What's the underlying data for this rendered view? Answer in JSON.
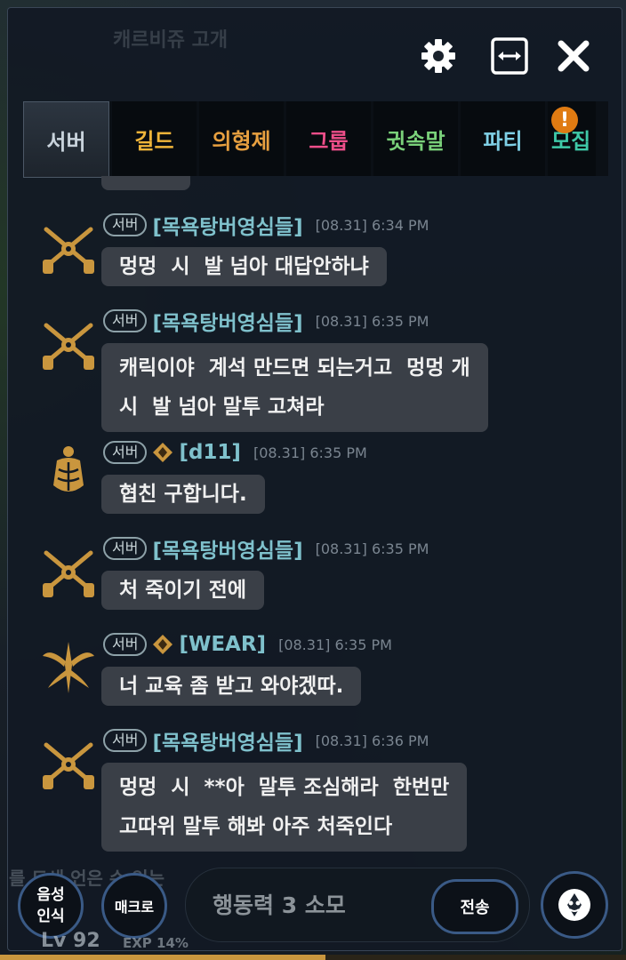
{
  "header": {
    "bg_title": "캐르비쥬 고개",
    "settings_icon": "gear-icon",
    "resize_icon": "expand-horizontal-icon",
    "close_icon": "close-icon"
  },
  "tabs": [
    {
      "label": "서버",
      "color": "#c9d3dc",
      "active": true
    },
    {
      "label": "길드",
      "color": "#f0b53a"
    },
    {
      "label": "의형제",
      "color": "#e8a040"
    },
    {
      "label": "그룹",
      "color": "#ef4f8a"
    },
    {
      "label": "귓속말",
      "color": "#7ad17a"
    },
    {
      "label": "파티",
      "color": "#7fd0e6"
    },
    {
      "label": "모집",
      "color": "#3fc9a8"
    }
  ],
  "tab_alert": "!",
  "messages": [
    {
      "channel": "서버",
      "name": "[목욕탕버영심들]",
      "time": "[08.31] 6:34 PM",
      "text": "멍멍  시  발 넘아 대답안하냐",
      "avatar": "crossed-pistols-icon"
    },
    {
      "channel": "서버",
      "name": "[목욕탕버영심들]",
      "time": "[08.31] 6:35 PM",
      "text": "캐릭이야  계석 만드면 되는거고  멍멍 개\n시  발 넘아 말투 고쳐라",
      "avatar": "crossed-pistols-icon"
    },
    {
      "channel": "서버",
      "name": "[d11]",
      "time": "[08.31] 6:35 PM",
      "text": "협친 구합니다.",
      "avatar": "armored-warrior-icon",
      "rank_icon": "rank-diamond-icon"
    },
    {
      "channel": "서버",
      "name": "[목욕탕버영심들]",
      "time": "[08.31] 6:35 PM",
      "text": "처 죽이기 전에",
      "avatar": "crossed-pistols-icon"
    },
    {
      "channel": "서버",
      "name": "[WEAR]",
      "time": "[08.31] 6:35 PM",
      "text": "너 교육 좀 받고 와야겠따.",
      "avatar": "winged-dagger-icon",
      "rank_icon": "rank-diamond-icon"
    },
    {
      "channel": "서버",
      "name": "[목욕탕버영심들]",
      "time": "[08.31] 6:36 PM",
      "text": "멍멍  시  **아  말투 조심해라  한번만\n고따위 말투 해봐 아주 처죽인다",
      "avatar": "crossed-pistols-icon"
    }
  ],
  "bottom": {
    "voice_label": "음성\n인식",
    "macro_label": "매크로",
    "input_placeholder": "행동력 3 소모",
    "send_label": "전송",
    "emote_icon": "emoticon-face-icon",
    "level_text": "Lv 92",
    "exp_text": "EXP 14%",
    "bg_text": "를 도새 언은 수 있는 "
  }
}
